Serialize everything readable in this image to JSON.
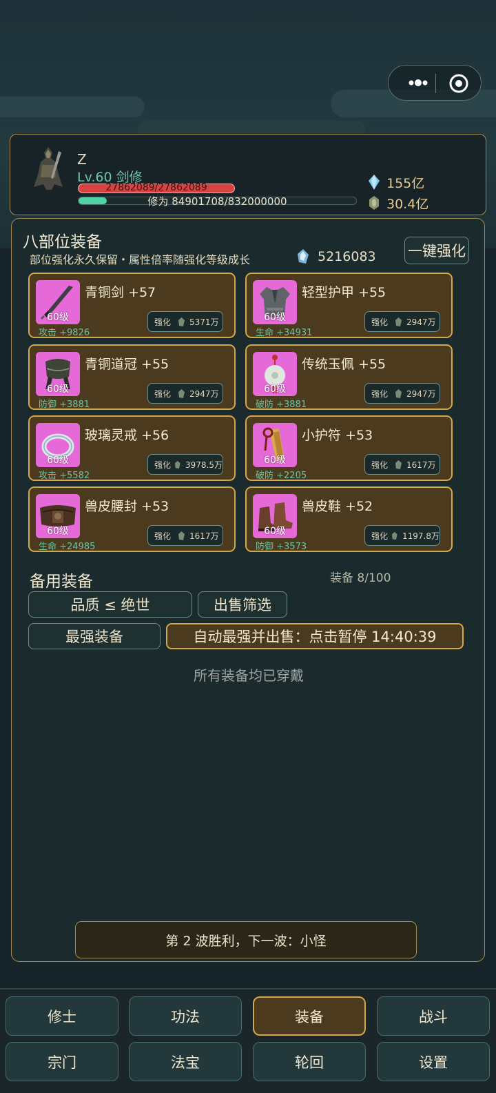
{
  "player": {
    "name": "Z",
    "level": "Lv.60 剑修",
    "hp_text": "27862089/27862089",
    "xp_text": "修为 84901708/832000000",
    "xp_fraction": 0.102,
    "currency_crystal": "155亿",
    "currency_stone": "30.4亿"
  },
  "equip_section": {
    "title": "八部位装备",
    "description": "部位强化永久保留・属性倍率随强化等级成长",
    "stone_count": "5216083",
    "oneclick_label": "一键强化"
  },
  "equipment": [
    {
      "name": "青铜剑 +57",
      "level": "60级",
      "stat": "攻击 +9826",
      "enh_label": "强化",
      "cost": "5371万",
      "icon": "sword-icon"
    },
    {
      "name": "轻型护甲 +55",
      "level": "60级",
      "stat": "生命 +34931",
      "enh_label": "强化",
      "cost": "2947万",
      "icon": "armor-icon"
    },
    {
      "name": "青铜道冠 +55",
      "level": "60级",
      "stat": "防御 +3881",
      "enh_label": "强化",
      "cost": "2947万",
      "icon": "crown-icon"
    },
    {
      "name": "传统玉佩 +55",
      "level": "60级",
      "stat": "破防 +3881",
      "enh_label": "强化",
      "cost": "2947万",
      "icon": "jade-pendant-icon"
    },
    {
      "name": "玻璃灵戒 +56",
      "level": "60级",
      "stat": "攻击 +5582",
      "enh_label": "强化",
      "cost": "3978.5万",
      "icon": "ring-icon"
    },
    {
      "name": "小护符 +53",
      "level": "60级",
      "stat": "破防 +2205",
      "enh_label": "强化",
      "cost": "1617万",
      "icon": "talisman-icon"
    },
    {
      "name": "兽皮腰封 +53",
      "level": "60级",
      "stat": "生命 +24985",
      "enh_label": "强化",
      "cost": "1617万",
      "icon": "belt-icon"
    },
    {
      "name": "兽皮鞋 +52",
      "level": "60级",
      "stat": "防御 +3573",
      "enh_label": "强化",
      "cost": "1197.8万",
      "icon": "boots-icon"
    }
  ],
  "spare": {
    "title": "备用装备",
    "count": "装备 8/100",
    "quality_filter": "品质 ≤ 绝世",
    "sell_filter": "出售筛选",
    "best_equip": "最强装备",
    "auto_sell": "自动最强并出售：点击暂停 14:40:39",
    "empty_msg": "所有装备均已穿戴"
  },
  "wave_msg": "第 2 波胜利，下一波：小怪",
  "nav": {
    "row1": [
      "修士",
      "功法",
      "装备",
      "战斗"
    ],
    "row2": [
      "宗门",
      "法宝",
      "轮回",
      "设置"
    ],
    "active": "装备"
  },
  "colors": {
    "card_bg": "#4c3a1f",
    "card_border": "#d3a74b",
    "icon_bg": "#e56ad7",
    "stat_green": "#69c4a2",
    "hp_red": "#d74342",
    "xp_green": "#4ed2a6"
  }
}
